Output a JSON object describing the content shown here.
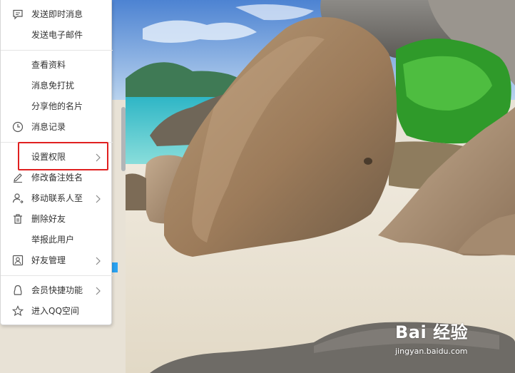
{
  "menu": {
    "items": [
      {
        "label": "发送即时消息",
        "icon": "chat-bubble-icon",
        "submenu": false
      },
      {
        "label": "发送电子邮件",
        "icon": "",
        "submenu": false
      },
      {
        "label": "查看资料",
        "icon": "",
        "submenu": false
      },
      {
        "label": "消息免打扰",
        "icon": "",
        "submenu": false
      },
      {
        "label": "分享他的名片",
        "icon": "",
        "submenu": false
      },
      {
        "label": "消息记录",
        "icon": "clock-icon",
        "submenu": false
      },
      {
        "label": "设置权限",
        "icon": "",
        "submenu": true,
        "highlighted": true
      },
      {
        "label": "修改备注姓名",
        "icon": "pencil-icon",
        "submenu": false
      },
      {
        "label": "移动联系人至",
        "icon": "person-move-icon",
        "submenu": true
      },
      {
        "label": "删除好友",
        "icon": "trash-icon",
        "submenu": false
      },
      {
        "label": "举报此用户",
        "icon": "",
        "submenu": false
      },
      {
        "label": "好友管理",
        "icon": "person-card-icon",
        "submenu": true
      },
      {
        "label": "会员快捷功能",
        "icon": "penguin-icon",
        "submenu": true
      },
      {
        "label": "进入QQ空间",
        "icon": "star-icon",
        "submenu": false
      }
    ]
  },
  "highlight_color": "#e02020",
  "watermark": {
    "logo_text": "Bai 经验",
    "url_text": "jingyan.baidu.com"
  }
}
